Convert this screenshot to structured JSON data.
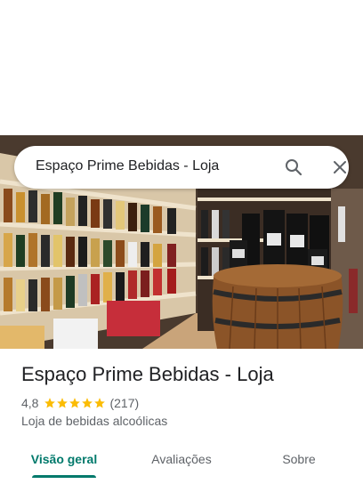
{
  "search": {
    "query": "Espaço Prime Bebidas - Loja",
    "search_icon": "search-icon",
    "close_icon": "close-icon"
  },
  "place": {
    "title": "Espaço Prime Bebidas - Loja",
    "rating": "4,8",
    "stars": 5,
    "review_count": "(217)",
    "category": "Loja de bebidas alcoólicas"
  },
  "tabs": [
    {
      "label": "Visão geral",
      "active": true
    },
    {
      "label": "Avaliações",
      "active": false
    },
    {
      "label": "Sobre",
      "active": false
    }
  ],
  "colors": {
    "accent": "#00796b",
    "star": "#fbbc04",
    "muted_text": "#5f6368"
  }
}
